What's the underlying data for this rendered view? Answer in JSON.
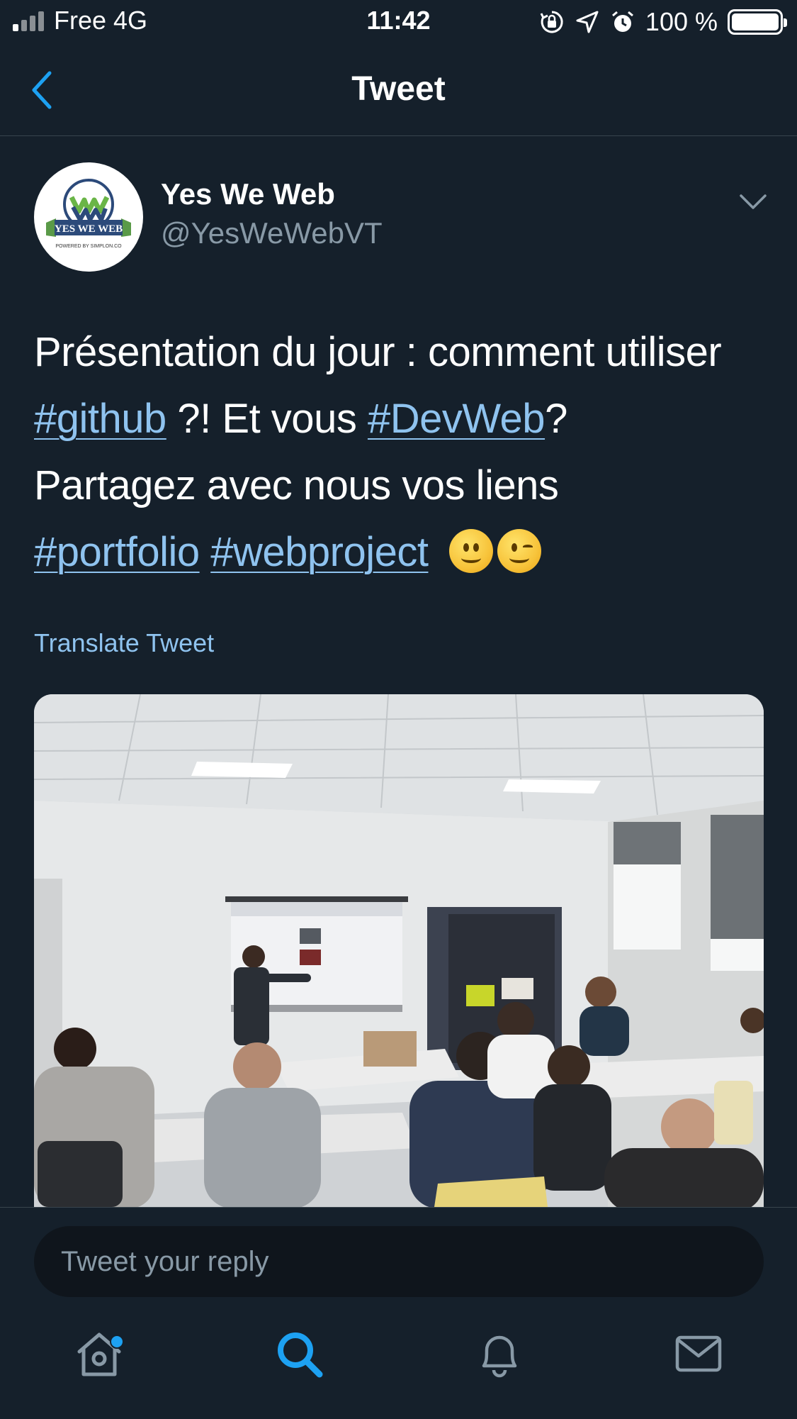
{
  "status_bar": {
    "carrier": "Free   4G",
    "time": "11:42",
    "battery": "100 %",
    "icons": [
      "signal-icon",
      "orientation-lock-icon",
      "location-icon",
      "alarm-icon",
      "battery-icon"
    ]
  },
  "header": {
    "title": "Tweet",
    "back_icon": "chevron-left-icon"
  },
  "tweet": {
    "author": {
      "name": "Yes We Web",
      "handle": "@YesWeWebVT",
      "avatar_logo_text": "YES WE WEB",
      "avatar_logo_subtext": "POWERED BY SIMPLON.CO"
    },
    "text": {
      "line1": "Présentation du jour : comment utiliser",
      "hashtag1": "#github",
      "mid1": " ?! Et vous ",
      "hashtag2": "#DevWeb",
      "mid2": "?",
      "line3": "Partagez avec nous vos liens",
      "hashtag3": "#portfolio",
      "space": " ",
      "hashtag4": "#webproject"
    },
    "emojis": [
      "slightly-smiling-face",
      "winking-face"
    ],
    "translate_label": "Translate Tweet",
    "photo_description_icon": "classroom-photo"
  },
  "reply": {
    "placeholder": "Tweet your reply"
  },
  "tab_bar": {
    "tabs": [
      "home-icon",
      "search-icon",
      "notifications-icon",
      "messages-icon"
    ],
    "active": "search-icon"
  },
  "colors": {
    "background": "#15202b",
    "link": "#8fc3ef",
    "secondary_text": "#8899a6",
    "accent": "#1da1f2",
    "divider": "#38444d"
  }
}
